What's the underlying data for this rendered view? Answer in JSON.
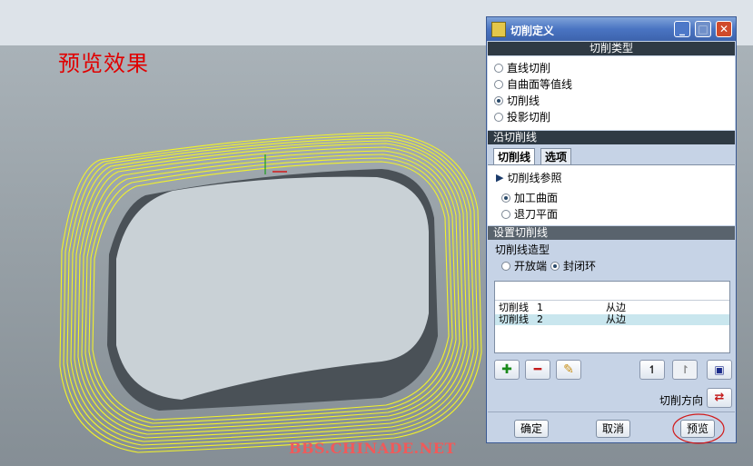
{
  "annotation": "预览效果",
  "watermark": "BBS.CHINADE.NET",
  "dialog": {
    "title": "切削定义",
    "window_buttons": {
      "minimize": "_",
      "maximize": "□",
      "close": "✕"
    },
    "cut_type": {
      "header": "切削类型",
      "options": [
        {
          "label": "直线切削",
          "selected": false
        },
        {
          "label": "自曲面等值线",
          "selected": false
        },
        {
          "label": "切削线",
          "selected": true
        },
        {
          "label": "投影切削",
          "selected": false
        }
      ]
    },
    "along_cut_line": {
      "header": "沿切削线",
      "tabs": [
        "切削线",
        "选项"
      ],
      "reference_label": "切削线参照",
      "reference_options": [
        {
          "label": "加工曲面",
          "selected": true
        },
        {
          "label": "退刀平面",
          "selected": false
        }
      ]
    },
    "set_cut_line": {
      "header": "设置切削线",
      "shape_label": "切削线造型",
      "shape_options": [
        {
          "label": "开放端",
          "selected": false
        },
        {
          "label": "封闭环",
          "selected": true
        }
      ],
      "rows": [
        {
          "name": "切削线",
          "num": "1",
          "mode": "从边",
          "selected": false
        },
        {
          "name": "切削线",
          "num": "2",
          "mode": "从边",
          "selected": true
        }
      ],
      "direction_label": "切削方向"
    },
    "buttons": {
      "ok": "确定",
      "cancel": "取消",
      "preview": "预览"
    },
    "colors": {
      "header_bg": "#2f3a44",
      "selected_row": "#c9e6ee",
      "highlight_circle": "#d11a1a",
      "toolpath": "#f2f22a"
    }
  }
}
